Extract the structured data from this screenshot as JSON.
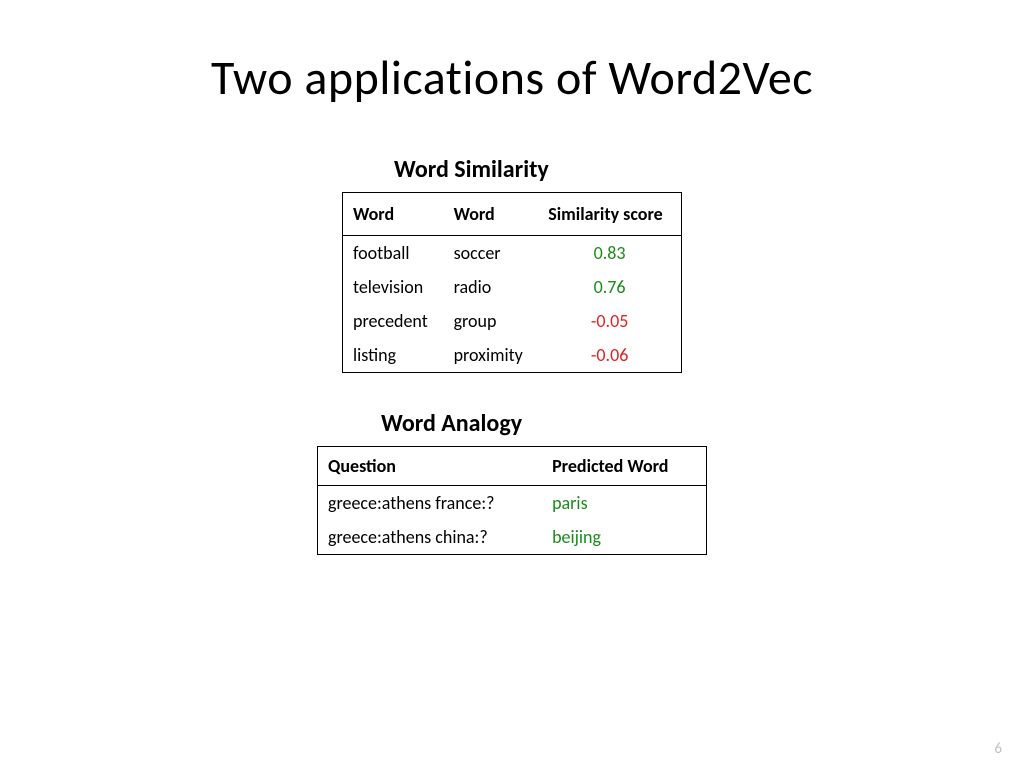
{
  "title": "Two applications of Word2Vec",
  "similarity": {
    "heading": "Word Similarity",
    "headers": {
      "c1": "Word",
      "c2": "Word",
      "c3": "Similarity score"
    },
    "rows": [
      {
        "w1": "football",
        "w2": "soccer",
        "score": "0.83",
        "sign": "pos"
      },
      {
        "w1": "television",
        "w2": "radio",
        "score": "0.76",
        "sign": "pos"
      },
      {
        "w1": "precedent",
        "w2": "group",
        "score": "-0.05",
        "sign": "neg"
      },
      {
        "w1": "listing",
        "w2": "proximity",
        "score": "-0.06",
        "sign": "neg"
      }
    ]
  },
  "analogy": {
    "heading": "Word Analogy",
    "headers": {
      "c1": "Question",
      "c2": "Predicted Word"
    },
    "rows": [
      {
        "q": "greece:athens france:?",
        "pred": "paris"
      },
      {
        "q": "greece:athens china:?",
        "pred": "beijing"
      }
    ]
  },
  "page_number": "6"
}
